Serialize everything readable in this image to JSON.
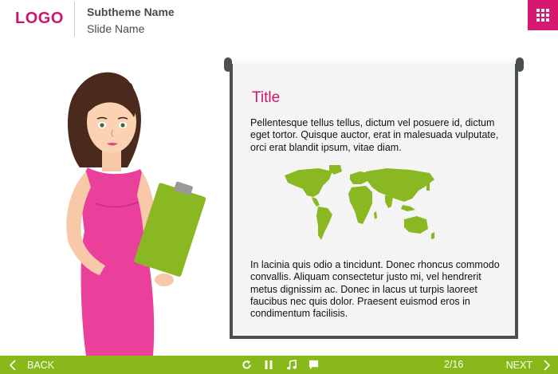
{
  "header": {
    "logo": "LOGO",
    "subtheme": "Subtheme Name",
    "slide_name": "Slide Name",
    "menu_icon": "grid-menu-icon"
  },
  "board": {
    "title": "Title",
    "paragraph1": "Pellentesque tellus tellus, dictum vel posuere id, dictum eget tortor. Quisque auctor, erat in malesuada vulputate, orci erat blandit ipsum, vitae diam.",
    "paragraph2": "In lacinia quis odio a tincidunt. Donec rhoncus commodo convallis. Aliquam consectetur justo mi, vel hendrerit metus dignissim ac. Donec in lacus ut turpis laoreet faucibus nec quis dolor. Praesent euismod eros in condimentum facilisis."
  },
  "footer": {
    "back_label": "BACK",
    "next_label": "NEXT",
    "page_indicator": "2/16",
    "controls": [
      "replay-icon",
      "pause-icon",
      "music-icon",
      "caption-icon"
    ]
  },
  "colors": {
    "accent_pink": "#d6186f",
    "footer_green": "#88b81a",
    "map_green": "#8ab823"
  }
}
